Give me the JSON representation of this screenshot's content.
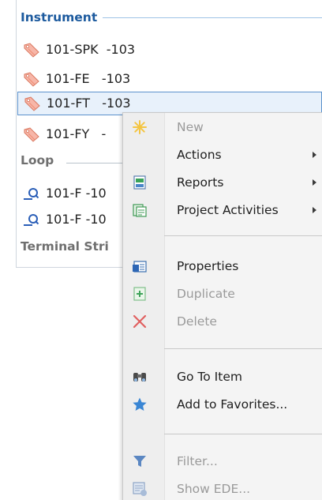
{
  "tree": {
    "groups": [
      {
        "title": "Instrument",
        "items": [
          {
            "label": "101-SPK  -103",
            "icon": "instrument-tag-icon"
          },
          {
            "label": "101-FE   -103",
            "icon": "instrument-tag-icon"
          },
          {
            "label": "101-FT   -103",
            "icon": "instrument-tag-icon",
            "selected": true
          },
          {
            "label": "101-FY   -",
            "icon": "instrument-tag-icon"
          }
        ]
      },
      {
        "title": "Loop",
        "items": [
          {
            "label": "101-F -10",
            "icon": "loop-icon"
          },
          {
            "label": "101-F -10",
            "icon": "loop-icon"
          }
        ]
      },
      {
        "title": "Terminal Stri",
        "items": []
      }
    ]
  },
  "context_menu": {
    "items": [
      {
        "label": "New",
        "icon": "new-star-icon",
        "enabled": false
      },
      {
        "label": "Actions",
        "icon": "",
        "enabled": true,
        "submenu": true
      },
      {
        "label": "Reports",
        "icon": "reports-icon",
        "enabled": true,
        "submenu": true
      },
      {
        "label": "Project Activities",
        "icon": "project-activities-icon",
        "enabled": true,
        "submenu": true
      },
      {
        "label": "Properties",
        "icon": "properties-icon",
        "enabled": true
      },
      {
        "label": "Duplicate",
        "icon": "duplicate-icon",
        "enabled": false
      },
      {
        "label": "Delete",
        "icon": "delete-x-icon",
        "enabled": false
      },
      {
        "label": "Go To Item",
        "icon": "binoculars-icon",
        "enabled": true
      },
      {
        "label": "Add to Favorites...",
        "icon": "favorites-star-icon",
        "enabled": true
      },
      {
        "label": "Filter...",
        "icon": "filter-funnel-icon",
        "enabled": false
      },
      {
        "label": "Show EDE...",
        "icon": "show-ede-icon",
        "enabled": false
      }
    ]
  },
  "colors": {
    "accent_header": "#1c5a9e",
    "selection_border": "#5c92cc",
    "selection_fill": "#e8f1fb",
    "menu_background": "#f4f4f4",
    "disabled_text": "#9a9a9a",
    "delete_red": "#e06060",
    "star_blue": "#3a86d4",
    "new_star_yellow": "#f4c542"
  }
}
